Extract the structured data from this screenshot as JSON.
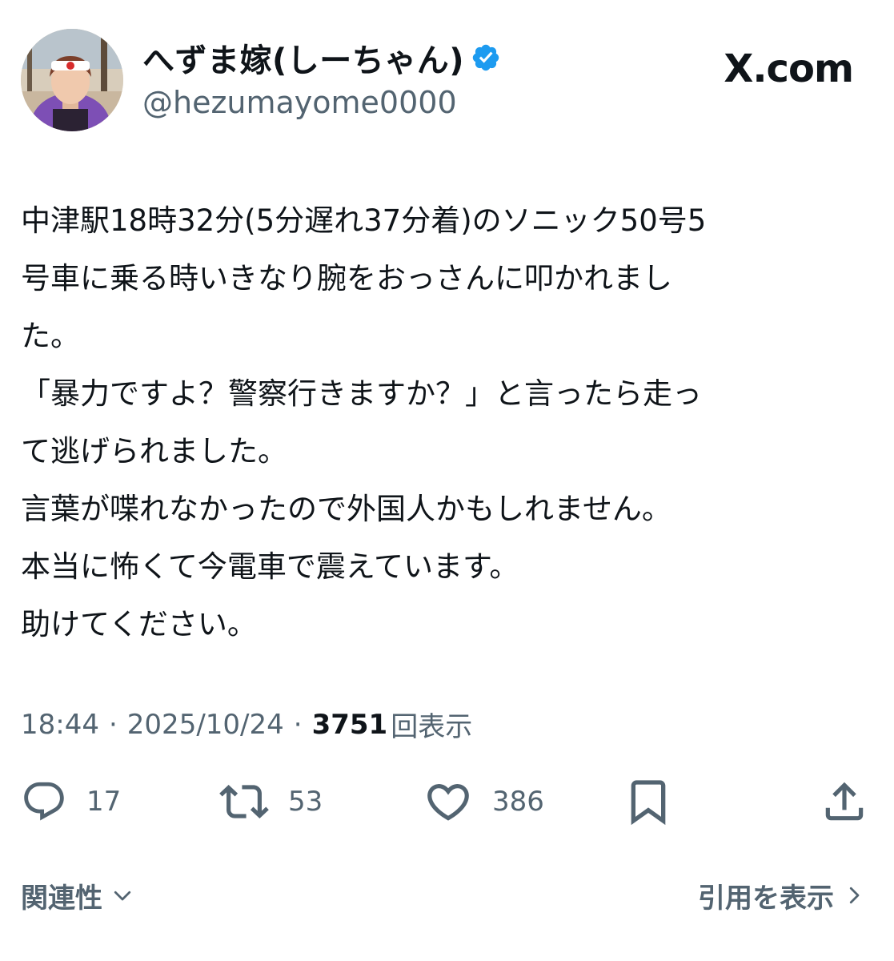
{
  "profile": {
    "display_name": "へずま嫁(しーちゃん)",
    "handle": "@hezumayome0000",
    "verified_icon": "verified-badge-icon",
    "avatar_icon": "avatar-photo"
  },
  "brand": {
    "text": "X.com"
  },
  "tweet": {
    "lines": [
      "中津駅18時32分(5分遅れ37分着)のソニック50号5",
      "号車に乗る時いきなり腕をおっさんに叩かれまし",
      "た。",
      "「暴力ですよ？警察行きますか？」と言ったら走っ",
      "て逃げられました。",
      "言葉が喋れなかったので外国人かもしれません。",
      "本当に怖くて今電車で震えています。",
      "助けてください。"
    ]
  },
  "meta": {
    "time": "18:44",
    "separator": "·",
    "date": "2025/10/24",
    "views_count": "3751",
    "views_label": "回表示"
  },
  "actions": {
    "reply_count": "17",
    "retweet_count": "53",
    "like_count": "386"
  },
  "footer": {
    "related_label": "関連性",
    "quotes_label": "引用を表示"
  },
  "colors": {
    "text_primary": "#0f1419",
    "text_secondary": "#536471",
    "verified_blue": "#1d9bf0"
  }
}
